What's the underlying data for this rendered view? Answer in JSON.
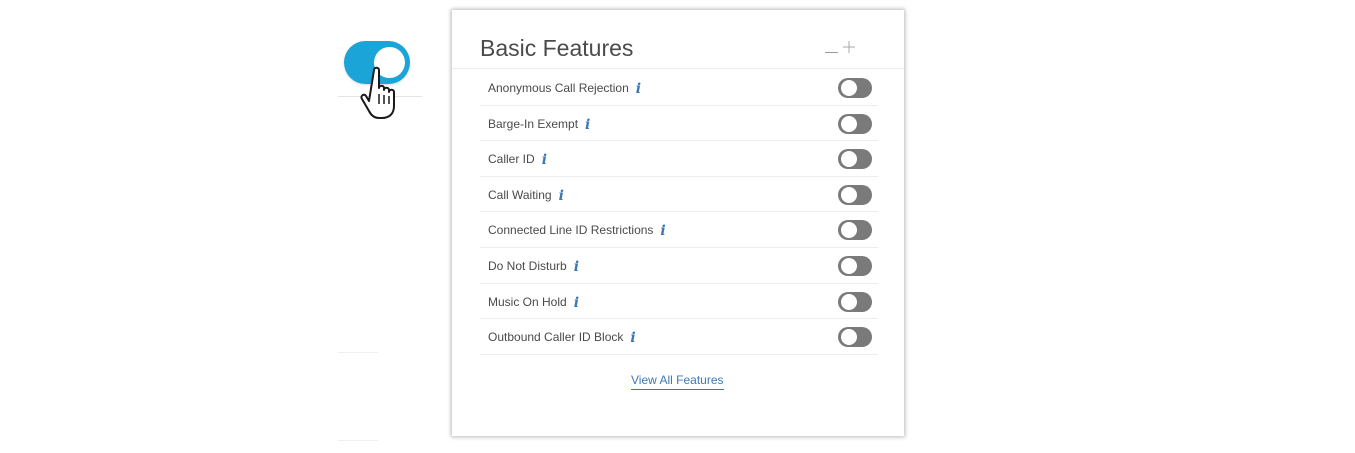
{
  "card": {
    "title": "Basic Features",
    "view_all_label": "View All Features"
  },
  "features": [
    {
      "label": "Anonymous Call Rejection",
      "enabled": false
    },
    {
      "label": "Barge-In Exempt",
      "enabled": false
    },
    {
      "label": "Caller ID",
      "enabled": false
    },
    {
      "label": "Call Waiting",
      "enabled": false
    },
    {
      "label": "Connected Line ID Restrictions",
      "enabled": false
    },
    {
      "label": "Do Not Disturb",
      "enabled": false
    },
    {
      "label": "Music On Hold",
      "enabled": false
    },
    {
      "label": "Outbound Caller ID Block",
      "enabled": false
    }
  ],
  "icons": {
    "info": "i",
    "demo_cursor": "hand-pointer-icon",
    "minimize": "minimize-icon",
    "move": "move-icon"
  },
  "demo_toggle": {
    "enabled": true
  },
  "colors": {
    "toggle_on": "#1ba4d8",
    "toggle_off": "#7a7a7a",
    "link": "#3d78b7",
    "info": "#3c78b4"
  }
}
